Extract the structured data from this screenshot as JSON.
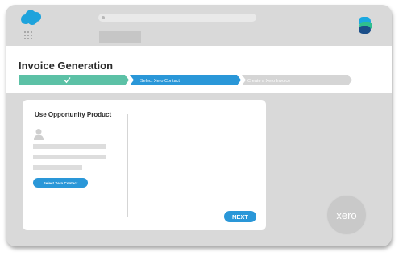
{
  "header": {
    "title": "Invoice Generation"
  },
  "stepper": {
    "steps": [
      {
        "label": "",
        "status": "complete",
        "color": "#5cc1a6"
      },
      {
        "label": "Select Xero Contact",
        "status": "active",
        "color": "#2a97d8"
      },
      {
        "label": "Create a Xero Invoice",
        "status": "pending",
        "color": "#d5d5d5"
      }
    ]
  },
  "card": {
    "title": "Use Opportunity Product",
    "select_button": "Select Xero Contact",
    "next_button": "NEXT"
  },
  "badge": {
    "text": "xero"
  },
  "icons": {
    "app_logo": "salesforce-cloud-icon",
    "launcher": "app-launcher-grid-icon",
    "search": "search-icon",
    "brand": "layers-app-icon",
    "contact": "person-icon",
    "check": "checkmark-icon"
  },
  "colors": {
    "accent": "#2a97d8",
    "success": "#5cc1a6",
    "frame": "#d9d9d9"
  }
}
